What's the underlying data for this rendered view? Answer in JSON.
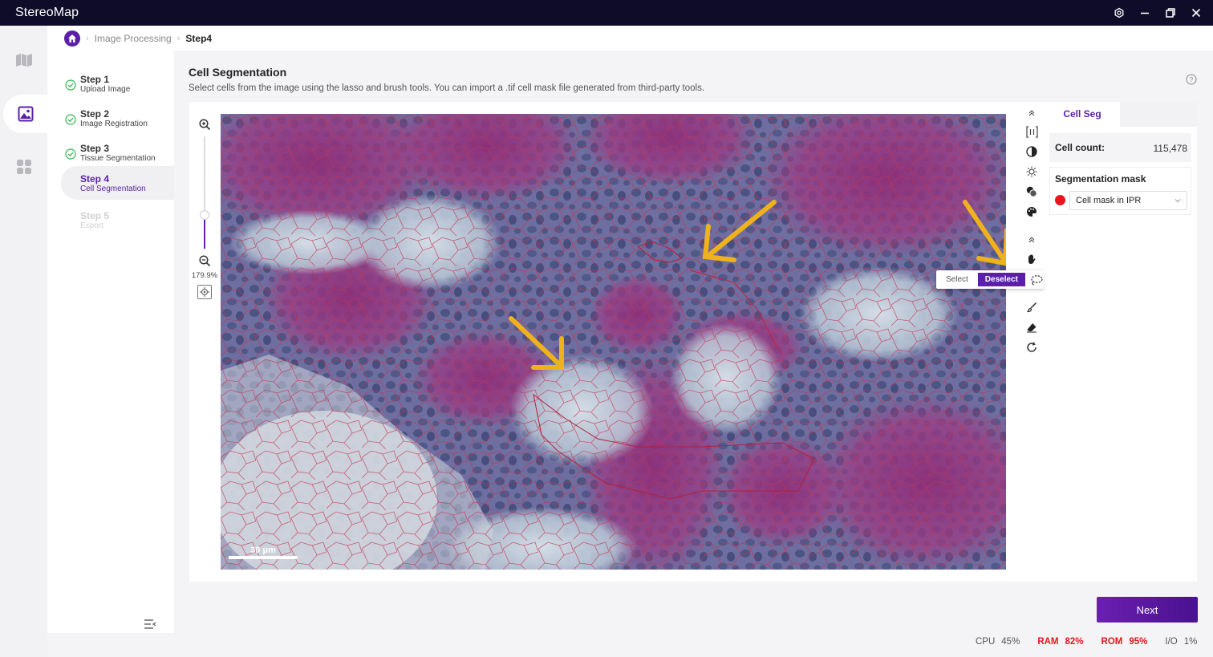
{
  "app": {
    "title": "StereoMap"
  },
  "breadcrumb": {
    "items": [
      "Image Processing",
      "Step4"
    ]
  },
  "steps": [
    {
      "title": "Step 1",
      "subtitle": "Upload Image",
      "state": "done"
    },
    {
      "title": "Step 2",
      "subtitle": "Image Registration",
      "state": "done"
    },
    {
      "title": "Step 3",
      "subtitle": "Tissue Segmentation",
      "state": "done"
    },
    {
      "title": "Step 4",
      "subtitle": "Cell Segmentation",
      "state": "active"
    },
    {
      "title": "Step 5",
      "subtitle": "Export",
      "state": "disabled"
    }
  ],
  "main": {
    "title": "Cell Segmentation",
    "description": "Select cells from the image using the lasso and brush tools. You can import a .tif cell mask file generated from third-party tools."
  },
  "viewer": {
    "zoom_level": "179.9%",
    "zoom_fraction": 0.3,
    "scale_bar": "30 μm"
  },
  "tools": {
    "selection_mode": {
      "options": [
        "Select",
        "Deselect"
      ],
      "selected": "Deselect"
    },
    "icons": [
      "collapse-up-icon",
      "channel-split-icon",
      "contrast-icon",
      "brightness-icon",
      "overlay-icon",
      "palette-icon",
      "collapse-up-icon",
      "hand-icon",
      "lasso-icon",
      "brush-icon",
      "eraser-icon",
      "reset-icon"
    ]
  },
  "right_panel": {
    "tab": "Cell Seg",
    "cell_count_label": "Cell count:",
    "cell_count_value": "115,478",
    "mask_title": "Segmentation mask",
    "mask_selected": "Cell mask in IPR",
    "mask_color": "#e8161c"
  },
  "next_button": "Next",
  "status": {
    "cpu_label": "CPU",
    "cpu_value": "45%",
    "ram_label": "RAM",
    "ram_value": "82%",
    "rom_label": "ROM",
    "rom_value": "95%",
    "io_label": "I/O",
    "io_value": "1%"
  },
  "colors": {
    "accent": "#5b1fa8",
    "titlebar": "#0f0c29",
    "warn": "#e8161c",
    "annotation_arrow": "#f0b21c"
  }
}
